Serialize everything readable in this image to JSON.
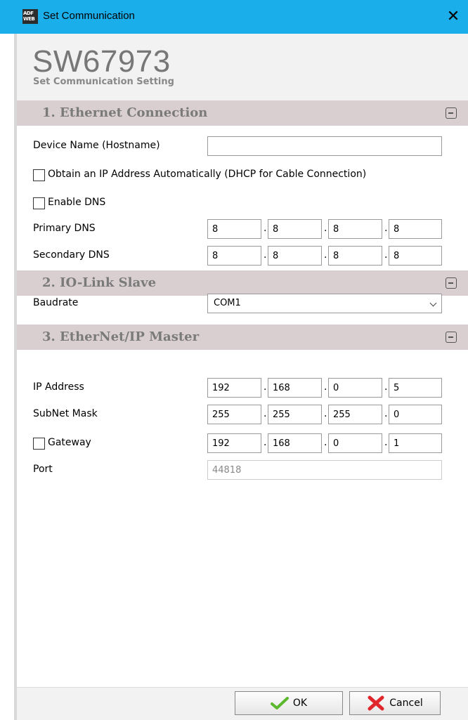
{
  "window": {
    "title": "Set Communication",
    "close_glyph": "✕"
  },
  "app_icon": {
    "name": "adfweb-icon",
    "line1": "ADF",
    "line2": "WEB"
  },
  "header": {
    "title": "SW67973",
    "subtitle": "Set Communication Setting"
  },
  "sections": [
    {
      "title": "1. Ethernet Connection"
    },
    {
      "title": "2. IO-Link Slave"
    },
    {
      "title": "3. EtherNet/IP Master"
    }
  ],
  "ethernet": {
    "device_name_label": "Device Name (Hostname)",
    "device_name_value": "",
    "dhcp_label": "Obtain an IP Address Automatically (DHCP for Cable Connection)",
    "dhcp_checked": false,
    "dns_label": "Enable DNS",
    "dns_checked": false,
    "primary_dns_label": "Primary DNS",
    "primary_dns": [
      "8",
      "8",
      "8",
      "8"
    ],
    "secondary_dns_label": "Secondary DNS",
    "secondary_dns": [
      "8",
      "8",
      "8",
      "8"
    ]
  },
  "iolink": {
    "baudrate_label": "Baudrate",
    "baudrate_value": "COM1"
  },
  "ethernetip": {
    "ip_label": "IP Address",
    "ip": [
      "192",
      "168",
      "0",
      "5"
    ],
    "subnet_label": "SubNet Mask",
    "subnet": [
      "255",
      "255",
      "255",
      "0"
    ],
    "gateway_label": "Gateway",
    "gateway_checked": false,
    "gateway": [
      "192",
      "168",
      "0",
      "1"
    ],
    "port_label": "Port",
    "port_value": "44818"
  },
  "ip_separator": ".",
  "footer": {
    "ok_label": "OK",
    "cancel_label": "Cancel"
  },
  "colors": {
    "titlebar": "#1aaeea",
    "section_header": "#d9cfd0",
    "ok_check": "#5cb82e",
    "cancel_x": "#e0262a"
  }
}
